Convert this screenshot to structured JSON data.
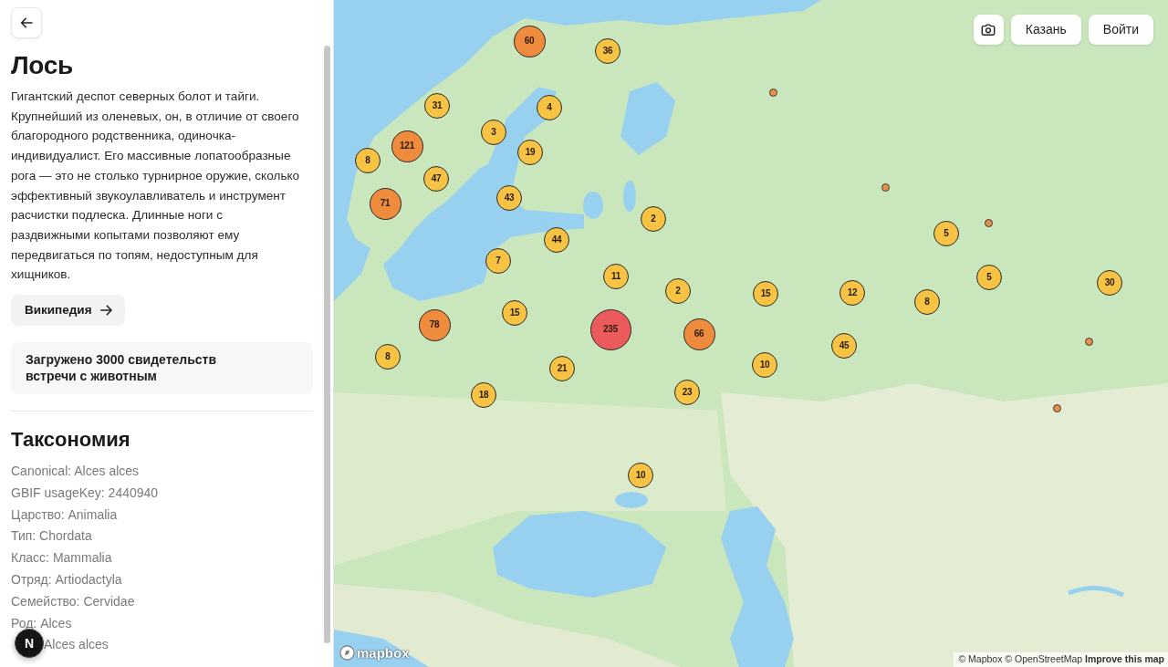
{
  "species": {
    "title": "Лось",
    "description": "Гигантский деспот северных болот и тайги. Крупнейший из оленевых, он, в отличие от своего благородного родственника, одиночка-индивидуалист. Его массивные лопатообразные рога — это не столько турнирное оружие, сколько эффективный звукоулавливатель и инструмент расчистки подлеска. Длинные ноги с раздвижными копытами позволяют ему передвигаться по топям, недоступным для хищников.",
    "wiki_button": "Википедия",
    "notice": "Загружено 3000 свидетельств встречи с животным"
  },
  "taxonomy": {
    "title": "Таксономия",
    "rows": [
      "Canonical: Alces alces",
      "GBIF usageKey: 2440940",
      "Царство: Animalia",
      "Тип: Chordata",
      "Класс: Mammalia",
      "Отряд: Artiodactyla",
      "Семейство: Cervidae",
      "Род: Alces",
      "Alces alces"
    ]
  },
  "dev_badge": "N",
  "map": {
    "toolbar": [
      {
        "kind": "camera"
      },
      {
        "kind": "location",
        "label": "Казань"
      },
      {
        "kind": "login",
        "label": "Войти"
      }
    ],
    "markers": [
      {
        "kind": "cluster",
        "count": "60",
        "color": "#ef8b3c"
      },
      {
        "kind": "cluster",
        "count": "36",
        "color": "#f6c344"
      },
      {
        "kind": "point",
        "color": "#e8904a"
      },
      {
        "kind": "cluster",
        "count": "31",
        "color": "#f6c344"
      },
      {
        "kind": "cluster",
        "count": "4",
        "color": "#f6c344"
      },
      {
        "kind": "cluster",
        "count": "3",
        "color": "#f6c344"
      },
      {
        "kind": "cluster",
        "count": "121",
        "color": "#ef8b3c"
      },
      {
        "kind": "cluster",
        "count": "19",
        "color": "#f6c344"
      },
      {
        "kind": "cluster",
        "count": "8",
        "color": "#f6c344"
      },
      {
        "kind": "cluster",
        "count": "47",
        "color": "#f6c344"
      },
      {
        "kind": "point",
        "color": "#e8904a"
      },
      {
        "kind": "cluster",
        "count": "43",
        "color": "#f6c344"
      },
      {
        "kind": "cluster",
        "count": "71",
        "color": "#ef8b3c"
      },
      {
        "kind": "cluster",
        "count": "2",
        "color": "#f6c344"
      },
      {
        "kind": "point",
        "color": "#e8904a"
      },
      {
        "kind": "cluster",
        "count": "5",
        "color": "#f6c344"
      },
      {
        "kind": "cluster",
        "count": "44",
        "color": "#f6c344"
      },
      {
        "kind": "cluster",
        "count": "7",
        "color": "#f6c344"
      },
      {
        "kind": "cluster",
        "count": "11",
        "color": "#f6c344"
      },
      {
        "kind": "cluster",
        "count": "5",
        "color": "#f6c344"
      },
      {
        "kind": "cluster",
        "count": "30",
        "color": "#f6c344"
      },
      {
        "kind": "cluster",
        "count": "2",
        "color": "#f6c344"
      },
      {
        "kind": "cluster",
        "count": "15",
        "color": "#f6c344"
      },
      {
        "kind": "cluster",
        "count": "12",
        "color": "#f6c344"
      },
      {
        "kind": "cluster",
        "count": "8",
        "color": "#f6c344"
      },
      {
        "kind": "cluster",
        "count": "15",
        "color": "#f6c344"
      },
      {
        "kind": "cluster",
        "count": "78",
        "color": "#ef8b3c"
      },
      {
        "kind": "cluster",
        "count": "235",
        "color": "#ec5b5b"
      },
      {
        "kind": "cluster",
        "count": "66",
        "color": "#ef8b3c"
      },
      {
        "kind": "point",
        "color": "#e8904a"
      },
      {
        "kind": "cluster",
        "count": "45",
        "color": "#f6c344"
      },
      {
        "kind": "cluster",
        "count": "8",
        "color": "#f6c344"
      },
      {
        "kind": "cluster",
        "count": "10",
        "color": "#f6c344"
      },
      {
        "kind": "cluster",
        "count": "21",
        "color": "#f6c344"
      },
      {
        "kind": "cluster",
        "count": "23",
        "color": "#f6c344"
      },
      {
        "kind": "cluster",
        "count": "18",
        "color": "#f6c344"
      },
      {
        "kind": "point",
        "color": "#e8904a"
      },
      {
        "kind": "cluster",
        "count": "10",
        "color": "#f6c344"
      }
    ],
    "logo": "mapbox",
    "attribution": {
      "links": [
        "© Mapbox",
        "© OpenStreetMap"
      ],
      "improve": "Improve this map"
    }
  }
}
